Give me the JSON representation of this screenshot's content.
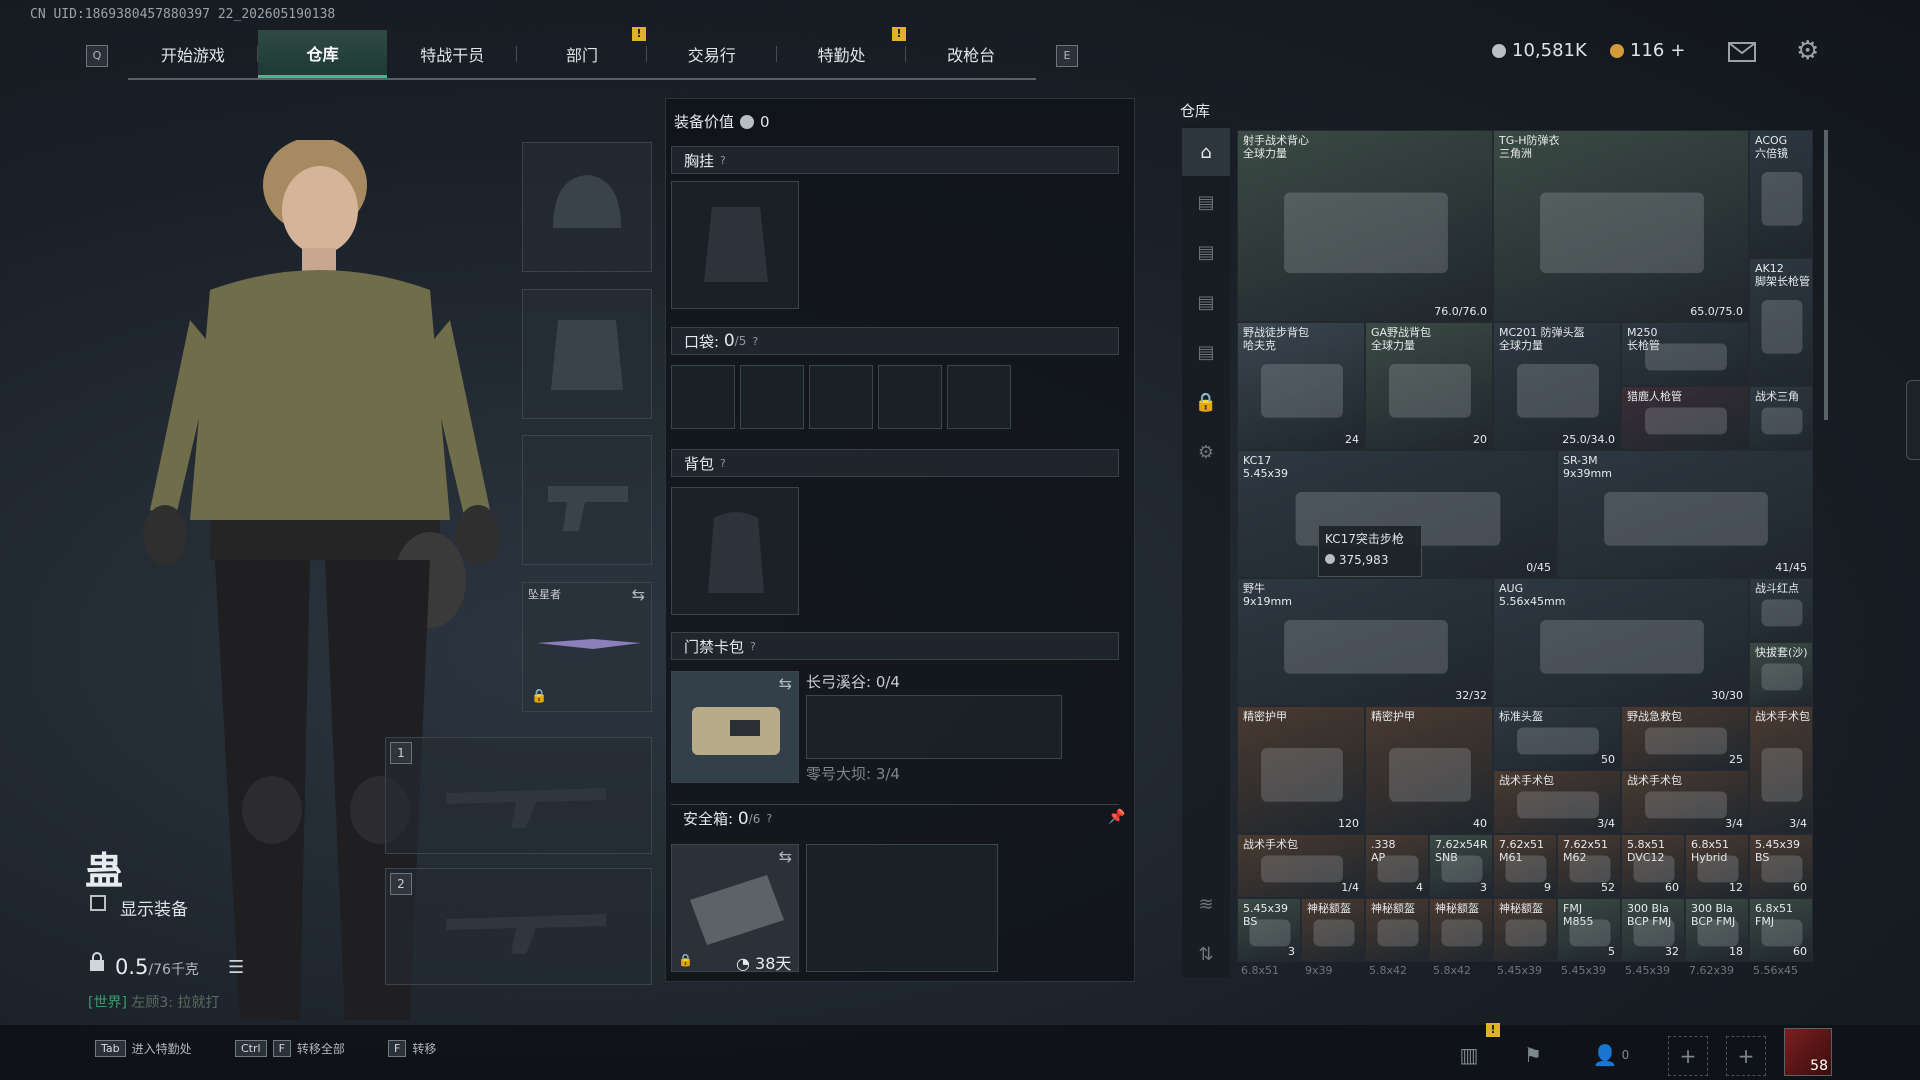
{
  "uid": "CN UID:1869380457880397 22_202605190138",
  "nav": {
    "left_key": "Q",
    "right_key": "E",
    "tabs": [
      "开始游戏",
      "仓库",
      "特战干员",
      "部门",
      "交易行",
      "特勤处",
      "改枪台"
    ],
    "warn_mark": "!"
  },
  "currency": {
    "money": "10,581K",
    "coins": "116",
    "plus": "+"
  },
  "character": {
    "name": "蛊",
    "show_equipment": "显示装备",
    "weight_value": "0.5",
    "weight_unit": "/76千克",
    "chat_channel": "[世界]",
    "chat_text": "左顾3: 拉就打",
    "melee_name": "坠星者",
    "weapon_slot_1": "1",
    "weapon_slot_2": "2"
  },
  "middle": {
    "equip_value_label": "装备价值",
    "equip_value": "0",
    "chest_rig": "胸挂",
    "pocket_label": "口袋:",
    "pocket_count": "0",
    "pocket_max": "/5",
    "backpack": "背包",
    "keycard": "门禁卡包",
    "keycard_line1": "长弓溪谷: 0/4",
    "keycard_line2": "零号大坝: 3/4",
    "safebox_label": "安全箱:",
    "safebox_count": "0",
    "safebox_max": "/6",
    "safebox_days": "38天",
    "question": "?"
  },
  "warehouse": {
    "title": "仓库",
    "tooltip_name": "KC17突击步枪",
    "tooltip_value": "375,983",
    "items": [
      {
        "name": "射手战术背心\n全球力量",
        "val": "76.0/76.0"
      },
      {
        "name": "TG-H防弹衣\n三角洲",
        "val": "65.0/75.0"
      },
      {
        "name": "ACOG\n六倍镜",
        "val": ""
      },
      {
        "name": "AK12\n脚架长枪管",
        "val": ""
      },
      {
        "name": "野战徒步背包\n哈夫克",
        "val": "24"
      },
      {
        "name": "GA野战背包\n全球力量",
        "val": "20"
      },
      {
        "name": "MC201 防弹头盔\n全球力量",
        "val": "25.0/34.0"
      },
      {
        "name": "M250\n长枪管",
        "val": ""
      },
      {
        "name": "猎鹿人枪管",
        "val": ""
      },
      {
        "name": "战术三角",
        "val": ""
      },
      {
        "name": "KC17\n5.45x39",
        "val": "0/45"
      },
      {
        "name": "SR-3M\n9x39mm",
        "val": "41/45"
      },
      {
        "name": "野牛\n9x19mm",
        "val": "32/32"
      },
      {
        "name": "AUG\n5.56x45mm",
        "val": "30/30"
      },
      {
        "name": "战斗红点",
        "val": ""
      },
      {
        "name": "快拔套(沙)",
        "val": ""
      },
      {
        "name": "精密护甲",
        "val": "120"
      },
      {
        "name": "精密护甲",
        "val": "40"
      },
      {
        "name": "标准头盔",
        "val": "50"
      },
      {
        "name": "野战急救包",
        "val": "25"
      },
      {
        "name": "战术手术包",
        "val": "3/4"
      },
      {
        "name": "战术手术包",
        "val": "3/4"
      },
      {
        "name": "战术手术包",
        "val": "3/4"
      },
      {
        "name": "战术手术包",
        "val": "1/4"
      },
      {
        "name": ".338\nAP",
        "val": "4"
      },
      {
        "name": "7.62x54R\nSNB",
        "val": "3"
      },
      {
        "name": "7.62x51\nM61",
        "val": "9"
      },
      {
        "name": "7.62x51\nM62",
        "val": "52"
      },
      {
        "name": "5.8x51\nDVC12",
        "val": "60"
      },
      {
        "name": "6.8x51\nHybrid",
        "val": "12"
      },
      {
        "name": "5.45x39\nBS",
        "val": "60"
      },
      {
        "name": "5.45x39\nBS",
        "val": "3"
      },
      {
        "name": "神秘额盔",
        "val": ""
      },
      {
        "name": "神秘额盔",
        "val": ""
      },
      {
        "name": "神秘额盔",
        "val": ""
      },
      {
        "name": "神秘额盔",
        "val": ""
      },
      {
        "name": "FMJ\nM855",
        "val": "5"
      },
      {
        "name": "300 Bla\nBCP FMJ",
        "val": "32"
      },
      {
        "name": "300 Bla\nBCP FMJ",
        "val": "18"
      },
      {
        "name": "6.8x51\nFMJ",
        "val": "60"
      }
    ],
    "bottom_row": [
      "6.8x51",
      "9x39",
      "5.8x42",
      "5.8x42",
      "5.45x39",
      "5.45x39",
      "5.45x39",
      "7.62x39",
      "5.56x45"
    ]
  },
  "bottom": {
    "hint1_key": "Tab",
    "hint1": "进入特勤处",
    "hint2_key1": "Ctrl",
    "hint2_key2": "F",
    "hint2": "转移全部",
    "hint3_key": "F",
    "hint3": "转移",
    "friends": "0",
    "level": "58"
  }
}
